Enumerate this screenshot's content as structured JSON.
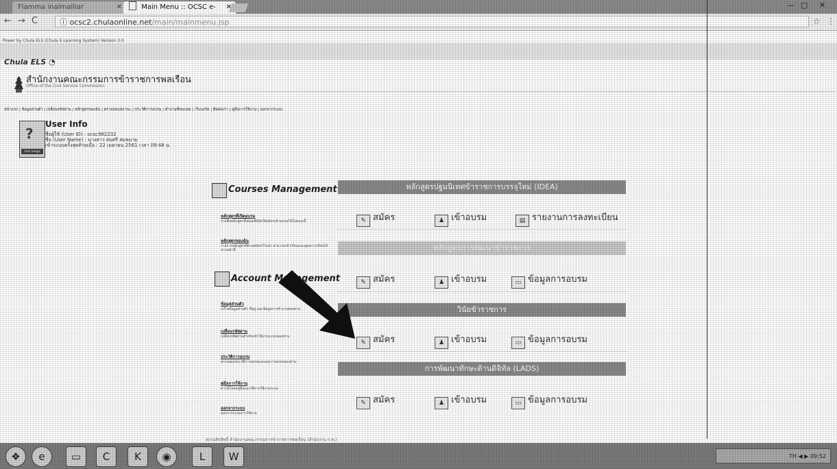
{
  "browser": {
    "tabs": [
      {
        "label": "Flamma  inalmalliar"
      },
      {
        "label": "Main Menu :: OCSC e-"
      }
    ],
    "url_host": "ocsc2.chulaonline.net",
    "url_path": "/main/mainmenu.jsp",
    "win_min": "—",
    "win_max": "▢",
    "win_close": "✕"
  },
  "page": {
    "powered_by": "Power by Chula ELS (Chula E-Learning System) Version 3.0",
    "brand": "Chula ELS",
    "org_name": "สำนักงานคณะกรรมการข้าราชการพลเรือน",
    "org_sub": "Office of the Civil Service Commission",
    "menu": "หน้าแรก | ข้อมูลส่วนตัว | เปลี่ยนรหัสผ่าน | หลักสูตรของฉัน | ตรวจสอบสถานะ | ประวัติการอบรม | คำถามที่พบบ่อย | เว็บบอร์ด | ติดต่อเรา | คู่มือการใช้งาน | ออกจากระบบ",
    "user_info": {
      "title": "User Info",
      "line1": "ชื่อผู้ใช้ (User ID) : ocsc982232",
      "line2": "ชื่อ (User Name) : นางสาว  สมศรี  สมหมาย",
      "line3": "เข้าระบบครั้งสุดท้ายเมื่อ : 22 เมษายน 2561 เวลา 09:48 น.",
      "avatar_caption": "User Image"
    },
    "left": {
      "courses_title": "Courses Management",
      "account_title": "Account Management",
      "items": [
        {
          "t": "หลักสูตรที่เปิดอบรม",
          "d": "รายชื่อหลักสูตรทั้งหมดที่เปิดให้สมัครเข้าอบรมได้ในขณะนี้"
        },
        {
          "t": "หลักสูตรของฉัน",
          "d": "รายการหลักสูตรที่ท่านสมัครไว้แล้ว สามารถเข้าเรียนและดูผลการเรียนได้จากหน้านี้"
        },
        {
          "t": "ข้อมูลส่วนตัว",
          "d": "แก้ไขข้อมูลส่วนตัว ที่อยู่ และข้อมูลการทำงานของท่าน"
        },
        {
          "t": "เปลี่ยนรหัสผ่าน",
          "d": "เปลี่ยนรหัสผ่านสำหรับเข้าใช้งานระบบของท่าน"
        },
        {
          "t": "ประวัติการอบรม",
          "d": "ตรวจสอบประวัติการอบรมและผลการอบรมของท่าน"
        },
        {
          "t": "คู่มือการใช้งาน",
          "d": "ดาวน์โหลดคู่มือและวิธีการใช้งานระบบ"
        },
        {
          "t": "ออกจากระบบ",
          "d": "ออกจากระบบการใช้งาน"
        }
      ]
    },
    "right": {
      "bars": [
        "หลักสูตรปฐมนิเทศข้าราชการบรรจุใหม่ (IDEA)",
        "หลักสูตรการพัฒนาข้าราชการ",
        "วินัยข้าราชการ",
        "การพัฒนาทักษะด้านดิจิทัล (LADS)"
      ],
      "apply": "สมัคร",
      "enter": "เข้าอบรม",
      "report": "รายงานการลงทะเบียน",
      "info": "ข้อมูลการอบรม"
    },
    "footer": "สงวนลิขสิทธิ์ สำนักงานคณะกรรมการข้าราชการพลเรือน (สำนักงาน ก.พ.)"
  },
  "taskbar": {
    "tray_text": "TH  ◀ ▶ 09:52"
  },
  "colors": {
    "bar": "#8a8a8a",
    "bar_light": "#c9c9c9",
    "taskbar": "#7c7c7c"
  }
}
